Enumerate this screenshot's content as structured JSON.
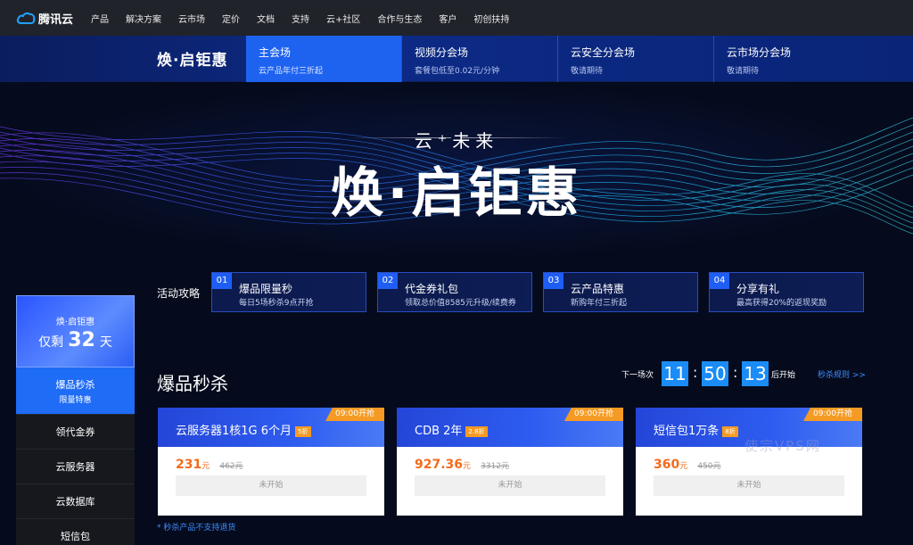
{
  "topnav": {
    "logo_text": "腾讯云",
    "items": [
      "产品",
      "解决方案",
      "云市场",
      "定价",
      "文档",
      "支持",
      "云+社区",
      "合作与生态",
      "客户",
      "初创扶持"
    ]
  },
  "subnav": {
    "title": "焕·启钜惠",
    "tabs": [
      {
        "label": "主会场",
        "desc": "云产品年付三折起"
      },
      {
        "label": "视频分会场",
        "desc": "套餐包低至0.02元/分钟"
      },
      {
        "label": "云安全分会场",
        "desc": "敬请期待"
      },
      {
        "label": "云市场分会场",
        "desc": "敬请期待"
      }
    ]
  },
  "hero": {
    "subtitle": "云⁺未来",
    "title": "焕·启钜惠"
  },
  "sidebar": {
    "countdown_title": "焕·启钜惠",
    "countdown_prefix": "仅剩",
    "countdown_days": "32",
    "countdown_suffix": "天",
    "items": [
      {
        "label": "爆品秒杀",
        "sub": "限量特惠"
      },
      {
        "label": "领代金券"
      },
      {
        "label": "云服务器"
      },
      {
        "label": "云数据库"
      },
      {
        "label": "短信包"
      }
    ]
  },
  "guide": {
    "label": "活动攻略",
    "cards": [
      {
        "num": "01",
        "title": "爆品限量秒",
        "desc": "每日5场秒杀9点开抢"
      },
      {
        "num": "02",
        "title": "代金券礼包",
        "desc": "领取总价值8585元升级/续费券"
      },
      {
        "num": "03",
        "title": "云产品特惠",
        "desc": "新购年付三折起"
      },
      {
        "num": "04",
        "title": "分享有礼",
        "desc": "最高获得20%的返现奖励"
      }
    ]
  },
  "flash": {
    "title": "爆品秒杀",
    "next_label": "下一场次",
    "hours": "11",
    "minutes": "50",
    "seconds": "13",
    "colon": ":",
    "start_label": "后开始",
    "rules_link": "秒杀规则 >>",
    "products": [
      {
        "name": "云服务器1核1G 6个月",
        "discount": "5折",
        "tag": "09:00开抢",
        "price": "231",
        "unit": "元",
        "original": "462元",
        "button": "未开始"
      },
      {
        "name": "CDB 2年",
        "discount": "2.8折",
        "tag": "09:00开抢",
        "price": "927.36",
        "unit": "元",
        "original": "3312元",
        "button": "未开始"
      },
      {
        "name": "短信包1万条",
        "discount": "8折",
        "tag": "09:00开抢",
        "price": "360",
        "unit": "元",
        "original": "450元",
        "button": "未开始"
      }
    ],
    "watermark": "使宗VPS网",
    "footnote": "* 秒杀产品不支持退货"
  },
  "colors": {
    "accent": "#1f6cf6",
    "price": "#f26b1d",
    "tag": "#f59b23",
    "link": "#3e8dff"
  }
}
